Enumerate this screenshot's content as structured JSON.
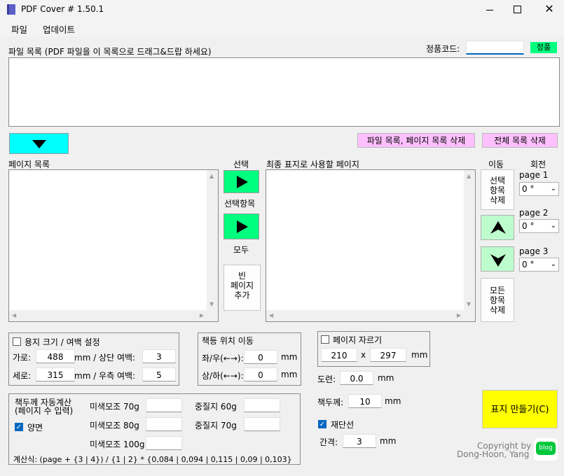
{
  "window": {
    "title": "PDF Cover # 1.50.1"
  },
  "menu": [
    "파일",
    "업데이트"
  ],
  "file_list": {
    "label": "파일 목록 (PDF 파일을 이 목록으로 드래그&드랍 하세요)"
  },
  "license": {
    "label": "정품코드:",
    "value": "",
    "badge": "정품"
  },
  "buttons": {
    "delete_file_page": "파일 목록, 페이지 목록 삭제",
    "delete_all": "전체 목록 삭제",
    "blank_page": "빈\n페이지\n추가",
    "delete_selected": "선택\n항목\n삭제",
    "delete_all_items": "모든\n항목\n삭제",
    "make_cover": "표지 만들기(C)"
  },
  "page_list": {
    "label": "페이지 목록"
  },
  "select": {
    "header": "선택",
    "selected_label": "선택항목",
    "all_label": "모두"
  },
  "final_pages": {
    "label": "최종 표지로 사용할 페이지"
  },
  "move": {
    "header": "이동"
  },
  "rotate": {
    "header": "회전",
    "pages": [
      {
        "label": "page 1",
        "value": "0 °"
      },
      {
        "label": "page 2",
        "value": "0 °"
      },
      {
        "label": "page 3",
        "value": "0 °"
      }
    ]
  },
  "paper": {
    "title": "용지 크기 / 여백 설정",
    "width_label": "가로:",
    "width": "488",
    "unit_top": "mm / 상단 여백:",
    "top_margin": "3",
    "height_label": "세로:",
    "height": "315",
    "unit_right": "mm / 우측 여백:",
    "right_margin": "5"
  },
  "spine_move": {
    "title": "책등 위치 이동",
    "lr_label": "좌/우(←→):",
    "lr": "0",
    "ud_label": "상/하(←→):",
    "ud": "0",
    "unit": "mm"
  },
  "crop": {
    "title": "페이지 자르기",
    "w": "210",
    "x": "x",
    "h": "297",
    "unit": "mm"
  },
  "bleed": {
    "label": "도련:",
    "value": "0.0",
    "unit": "mm"
  },
  "thickness": {
    "label": "책두께:",
    "value": "10",
    "unit": "mm"
  },
  "cutline": {
    "label": "재단선",
    "gap_label": "간격:",
    "gap": "3",
    "unit": "mm"
  },
  "auto_calc": {
    "title_line1": "책두께 자동계산",
    "title_line2": "(페이지 수 입력)",
    "duplex": "양면",
    "papers": [
      "미색모조 70g",
      "미색모조 80g",
      "미색모조 100g",
      "중질지 60g",
      "중질지 70g"
    ],
    "formula": "계산식: (page + {3 | 4}) / {1 | 2} * {0,084 | 0,094 | 0,115 | 0,09 | 0,103}"
  },
  "copyright": {
    "line1": "Copyright by",
    "line2": "Dong-Hoon, Yang",
    "logo_text": "blog"
  },
  "colors": {
    "cyan": "#00ffff",
    "green": "#00ff7f",
    "pink": "#ffc0ff",
    "yellow": "#ffff00",
    "badge": "#00ff7f"
  }
}
